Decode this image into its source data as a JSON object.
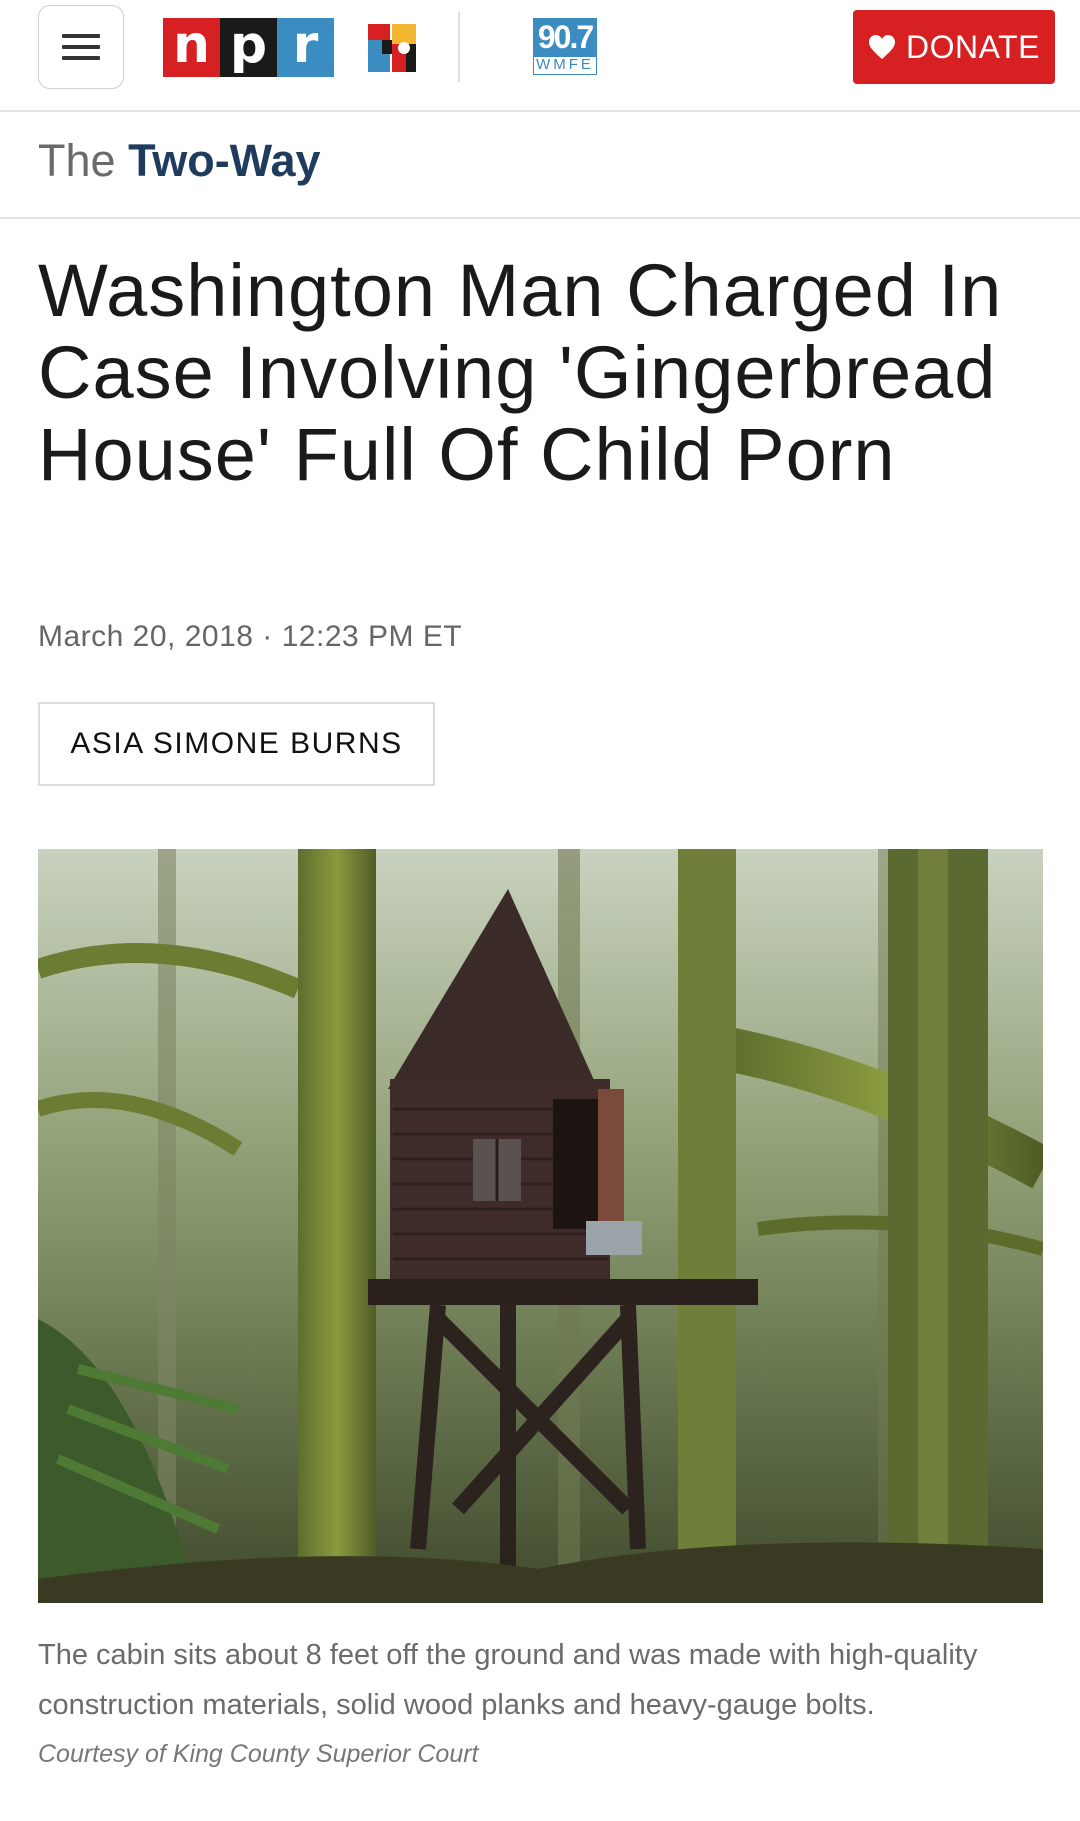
{
  "header": {
    "menu_icon": "hamburger-menu-icon",
    "logo_letters": [
      "n",
      "p",
      "r"
    ],
    "logo_colors": [
      "#d62021",
      "#1a1a1a",
      "#3a8cc1"
    ],
    "anniversary_badge": "npr-50-icon",
    "station": {
      "frequency": "90.7",
      "call_letters": "WMFE"
    },
    "donate": {
      "label": "DONATE",
      "icon": "heart-icon",
      "color": "#d62021"
    }
  },
  "section": {
    "prefix": "The",
    "name": "Two-Way"
  },
  "article": {
    "headline": "Washington Man Charged In Case Involving 'Gingerbread House' Full Of Child Porn",
    "dateline": "March 20, 2018 · 12:23 PM ET",
    "author": "ASIA SIMONE BURNS",
    "image": {
      "caption": "The cabin sits about 8 feet off the ground and was made with high-quality construction materials, solid wood planks and heavy-gauge bolts.",
      "credit": "Courtesy of King County Superior Court"
    }
  }
}
